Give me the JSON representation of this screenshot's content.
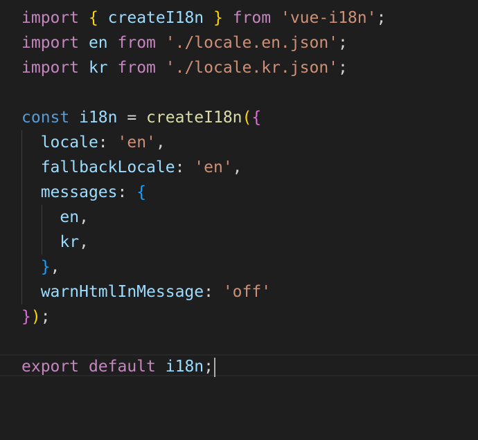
{
  "editor": {
    "theme_colors": {
      "background": "#1e1e1e",
      "keyword_control": "#c586c0",
      "keyword_storage": "#569cd6",
      "variable": "#9cdcfe",
      "function": "#dcdcaa",
      "string": "#ce9178",
      "bracket_level1": "#ffd700",
      "bracket_level2": "#da70d6",
      "bracket_level3": "#179fff"
    },
    "cursor_line": 15,
    "lines": [
      [
        {
          "t": "kw",
          "v": "import"
        },
        {
          "t": "p",
          "v": " "
        },
        {
          "t": "b1",
          "v": "{"
        },
        {
          "t": "p",
          "v": " "
        },
        {
          "t": "var",
          "v": "createI18n"
        },
        {
          "t": "p",
          "v": " "
        },
        {
          "t": "b1",
          "v": "}"
        },
        {
          "t": "p",
          "v": " "
        },
        {
          "t": "kw",
          "v": "from"
        },
        {
          "t": "p",
          "v": " "
        },
        {
          "t": "str",
          "v": "'vue-i18n'"
        },
        {
          "t": "p",
          "v": ";"
        }
      ],
      [
        {
          "t": "kw",
          "v": "import"
        },
        {
          "t": "p",
          "v": " "
        },
        {
          "t": "var",
          "v": "en"
        },
        {
          "t": "p",
          "v": " "
        },
        {
          "t": "kw",
          "v": "from"
        },
        {
          "t": "p",
          "v": " "
        },
        {
          "t": "str",
          "v": "'./locale.en.json'"
        },
        {
          "t": "p",
          "v": ";"
        }
      ],
      [
        {
          "t": "kw",
          "v": "import"
        },
        {
          "t": "p",
          "v": " "
        },
        {
          "t": "var",
          "v": "kr"
        },
        {
          "t": "p",
          "v": " "
        },
        {
          "t": "kw",
          "v": "from"
        },
        {
          "t": "p",
          "v": " "
        },
        {
          "t": "str",
          "v": "'./locale.kr.json'"
        },
        {
          "t": "p",
          "v": ";"
        }
      ],
      [],
      [
        {
          "t": "st",
          "v": "const"
        },
        {
          "t": "p",
          "v": " "
        },
        {
          "t": "var",
          "v": "i18n"
        },
        {
          "t": "p",
          "v": " = "
        },
        {
          "t": "fn",
          "v": "createI18n"
        },
        {
          "t": "b1",
          "v": "("
        },
        {
          "t": "b2",
          "v": "{"
        }
      ],
      [
        {
          "t": "p",
          "v": "  "
        },
        {
          "t": "var",
          "v": "locale"
        },
        {
          "t": "p",
          "v": ": "
        },
        {
          "t": "str",
          "v": "'en'"
        },
        {
          "t": "p",
          "v": ","
        }
      ],
      [
        {
          "t": "p",
          "v": "  "
        },
        {
          "t": "var",
          "v": "fallbackLocale"
        },
        {
          "t": "p",
          "v": ": "
        },
        {
          "t": "str",
          "v": "'en'"
        },
        {
          "t": "p",
          "v": ","
        }
      ],
      [
        {
          "t": "p",
          "v": "  "
        },
        {
          "t": "var",
          "v": "messages"
        },
        {
          "t": "p",
          "v": ": "
        },
        {
          "t": "b3",
          "v": "{"
        }
      ],
      [
        {
          "t": "p",
          "v": "    "
        },
        {
          "t": "var",
          "v": "en"
        },
        {
          "t": "p",
          "v": ","
        }
      ],
      [
        {
          "t": "p",
          "v": "    "
        },
        {
          "t": "var",
          "v": "kr"
        },
        {
          "t": "p",
          "v": ","
        }
      ],
      [
        {
          "t": "p",
          "v": "  "
        },
        {
          "t": "b3",
          "v": "}"
        },
        {
          "t": "p",
          "v": ","
        }
      ],
      [
        {
          "t": "p",
          "v": "  "
        },
        {
          "t": "var",
          "v": "warnHtmlInMessage"
        },
        {
          "t": "p",
          "v": ": "
        },
        {
          "t": "str",
          "v": "'off'"
        }
      ],
      [
        {
          "t": "b2",
          "v": "}"
        },
        {
          "t": "b1",
          "v": ")"
        },
        {
          "t": "p",
          "v": ";"
        }
      ],
      [],
      [
        {
          "t": "kw",
          "v": "export"
        },
        {
          "t": "p",
          "v": " "
        },
        {
          "t": "kw",
          "v": "default"
        },
        {
          "t": "p",
          "v": " "
        },
        {
          "t": "var",
          "v": "i18n"
        },
        {
          "t": "p",
          "v": ";"
        }
      ]
    ]
  }
}
